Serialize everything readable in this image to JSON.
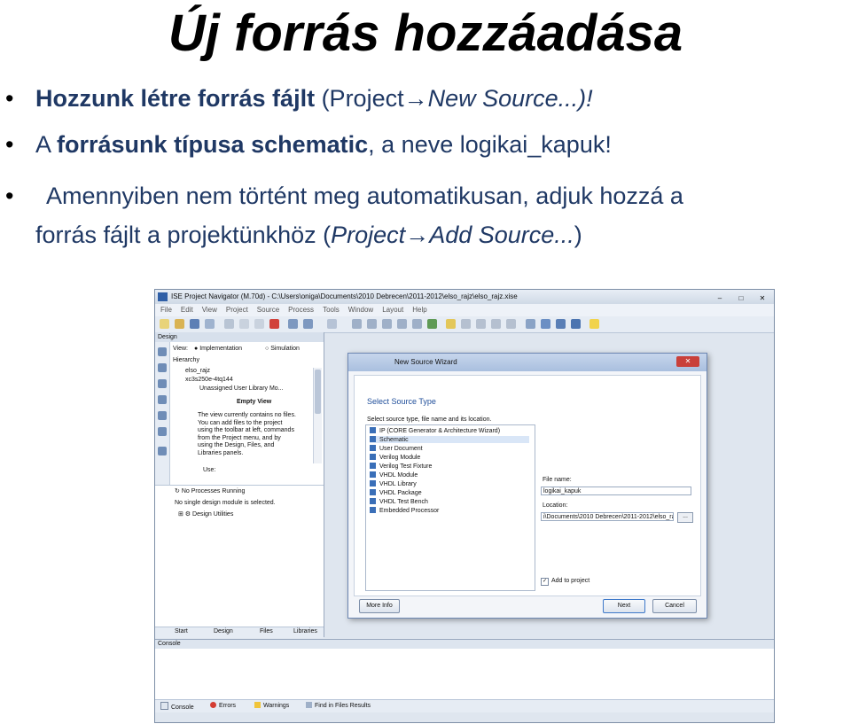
{
  "slide": {
    "title": "Új forrás hozzáadása",
    "bullet1_bold": "Hozzunk létre forrás fájlt",
    "bullet1_rest": " (Project",
    "bullet1_arrow": "→",
    "bullet1_tail": "New Source...)!",
    "bullet2_pre": "A ",
    "bullet2_bold": "forrásunk típusa schematic",
    "bullet2_rest": ", a neve logikai_kapuk!",
    "bullet3_line1": "Amennyiben nem történt meg automatikusan, adjuk hozzá a",
    "bullet3_line2_pre": "forrás fájlt a projektünkhöz (",
    "bullet3_line2_italic": "Project→Add Source...",
    "bullet3_line2_post": ")",
    "bullet_symbol": "•"
  },
  "window": {
    "title": "ISE Project Navigator (M.70d) - C:\\Users\\oniga\\Documents\\2010 Debrecen\\2011-2012\\elso_rajz\\elso_rajz.xise",
    "controls": [
      "–",
      "□",
      "✕"
    ],
    "menu": [
      "File",
      "Edit",
      "View",
      "Project",
      "Source",
      "Process",
      "Tools",
      "Window",
      "Layout",
      "Help"
    ],
    "design_panel": {
      "header": "Design",
      "view_label": "View:",
      "implementation": "Implementation",
      "simulation": "Simulation",
      "hierarchy": "Hierarchy",
      "tree": [
        "elso_rajz",
        "xc3s250e-4tq144",
        "Unassigned User Library Mo..."
      ],
      "empty_view_title": "Empty View",
      "empty_view_text": [
        "The view currently contains no files.",
        "You can add files to the project",
        "using the toolbar at left, commands",
        "from the Project menu, and by",
        "using the Design, Files, and",
        "Libraries panels."
      ],
      "use_label": "Use:"
    },
    "process_panel": {
      "status": "No Processes Running",
      "message": "No single design module is selected.",
      "item": "Design Utilities"
    },
    "bottom_tabs": [
      "Start",
      "Design",
      "Files",
      "Libraries"
    ],
    "dialog": {
      "title": "New Source Wizard",
      "close": "✕",
      "heading": "Select Source Type",
      "instruction": "Select source type, file name and its location.",
      "types": [
        "IP (CORE Generator & Architecture Wizard)",
        "Schematic",
        "User Document",
        "Verilog Module",
        "Verilog Test Fixture",
        "VHDL Module",
        "VHDL Library",
        "VHDL Package",
        "VHDL Test Bench",
        "Embedded Processor"
      ],
      "selected_type": "Schematic",
      "file_name_label": "File name:",
      "file_name_value": "logikai_kapuk",
      "location_label": "Location:",
      "location_value": "i\\Documents\\2010 Debrecen\\2011-2012\\elso_rajz",
      "browse": "...",
      "add_to_project": "Add to project",
      "add_checked": "✓",
      "more_info": "More Info",
      "next": "Next",
      "cancel": "Cancel"
    },
    "console": {
      "header": "Console",
      "tabs": [
        "Console",
        "Errors",
        "Warnings",
        "Find in Files Results"
      ]
    }
  },
  "colors": {
    "accent": "#1f3864",
    "dialog_title": "#a9bfdf",
    "close_button": "#c9403a",
    "heading_blue": "#1f4e9a"
  }
}
